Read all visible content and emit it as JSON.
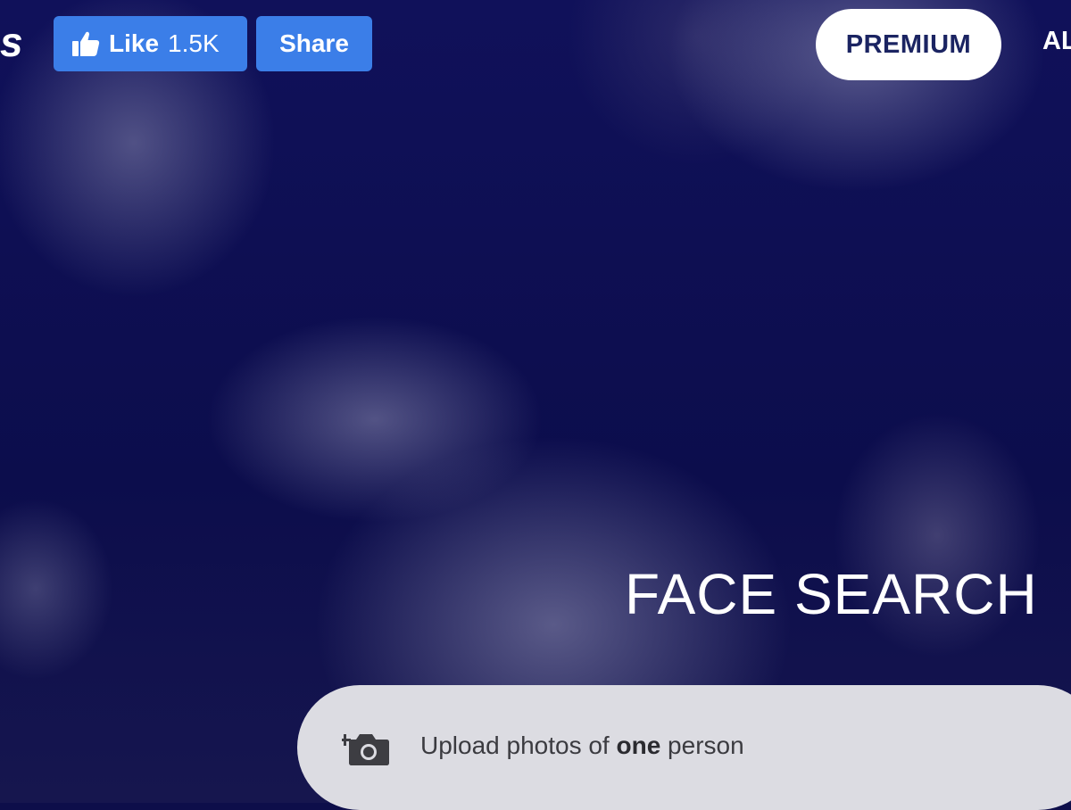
{
  "header": {
    "logo_fragment": "s",
    "like_button": {
      "label": "Like",
      "count": "1.5K"
    },
    "share_button": {
      "label": "Share"
    },
    "premium_button": {
      "label": "PREMIUM"
    },
    "nav_cut_label": "AL"
  },
  "hero": {
    "title": "FACE SEARCH"
  },
  "upload": {
    "text_before": "Upload photos of ",
    "text_bold": "one",
    "text_after": " person",
    "icon": "add-photo-camera-icon"
  },
  "colors": {
    "background": "#0d0e4a",
    "facebook_blue": "#3b7ee8",
    "premium_text": "#1b2462",
    "upload_bar": "#dcdce2"
  }
}
